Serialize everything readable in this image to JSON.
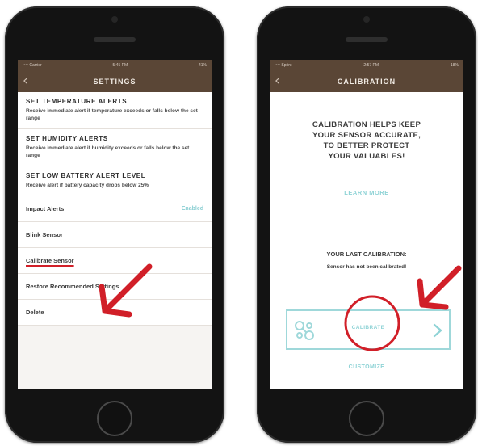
{
  "left_screen": {
    "status_left": "•••• Carrier",
    "status_time": "5:45 PM",
    "status_right": "41%",
    "back_icon": "chevron-left-icon",
    "title": "SETTINGS",
    "blocks": [
      {
        "title": "SET TEMPERATURE ALERTS",
        "desc": "Receive immediate alert if temperature exceeds or falls below the set range"
      },
      {
        "title": "SET HUMIDITY ALERTS",
        "desc": "Receive immediate alert if humidity exceeds or falls below the set range"
      },
      {
        "title": "SET LOW BATTERY ALERT LEVEL",
        "desc": "Receive alert if battery capacity drops below 25%"
      }
    ],
    "rows": [
      {
        "label": "Impact Alerts",
        "value": "Enabled"
      },
      {
        "label": "Blink Sensor"
      },
      {
        "label": "Calibrate Sensor"
      },
      {
        "label": "Restore Recommended Settings"
      },
      {
        "label": "Delete"
      }
    ]
  },
  "right_screen": {
    "status_left": "•••• Sprint",
    "status_time": "2:57 PM",
    "status_right": "18%",
    "back_icon": "chevron-left-icon",
    "title": "CALIBRATION",
    "headline": [
      "CALIBRATION HELPS KEEP",
      "YOUR SENSOR ACCURATE,",
      "TO BETTER PROTECT",
      "YOUR VALUABLES!"
    ],
    "learn_more": "LEARN MORE",
    "last_calibration_title": "YOUR LAST CALIBRATION:",
    "last_calibration_status": "Sensor has not been calibrated!",
    "calibrate_button": "CALIBRATE",
    "customize": "CUSTOMIZE",
    "panel_icon": "sensor-icon",
    "panel_chevron": "chevron-right-icon"
  },
  "colors": {
    "nav_brown": "#5a4636",
    "accent_teal": "#8fd3d6",
    "annotation_red": "#d11f28"
  }
}
